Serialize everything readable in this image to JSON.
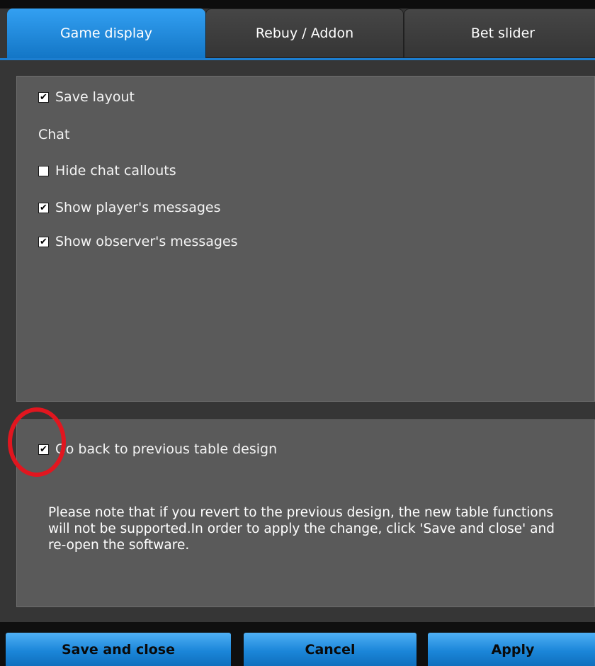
{
  "tabs": [
    {
      "label": "Game display",
      "active": true
    },
    {
      "label": "Rebuy / Addon",
      "active": false
    },
    {
      "label": "Bet slider",
      "active": false
    }
  ],
  "options": {
    "save_layout": {
      "label": "Save layout",
      "checked": true
    },
    "chat_heading": "Chat",
    "hide_chat_callouts": {
      "label": "Hide chat callouts",
      "checked": false
    },
    "show_players_messages": {
      "label": "Show player's messages",
      "checked": true
    },
    "show_observers_messages": {
      "label": "Show observer's messages",
      "checked": true
    }
  },
  "legacy": {
    "go_back": {
      "label": "Go back to previous table design",
      "checked": true
    },
    "note": "Please note that if you revert to the previous design, the new table functions will not be supported.In order to apply the change, click 'Save and close' and re-open the software."
  },
  "buttons": {
    "save_close": "Save and close",
    "cancel": "Cancel",
    "apply": "Apply"
  },
  "colors": {
    "accent_blue": "#1b86d9",
    "panel_gray": "#5a5a5a",
    "highlight_red": "#e1161f"
  }
}
